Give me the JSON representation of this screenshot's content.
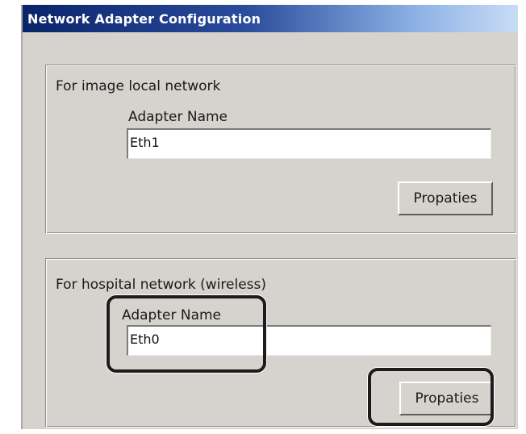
{
  "window": {
    "title": "Network Adapter Configuration"
  },
  "groups": [
    {
      "label": "For image local network",
      "adapter_label": "Adapter Name",
      "adapter_value": "Eth1",
      "button_label": "Propaties"
    },
    {
      "label": "For hospital network (wireless)",
      "adapter_label": "Adapter Name",
      "adapter_value": "Eth0",
      "button_label": "Propaties"
    }
  ]
}
